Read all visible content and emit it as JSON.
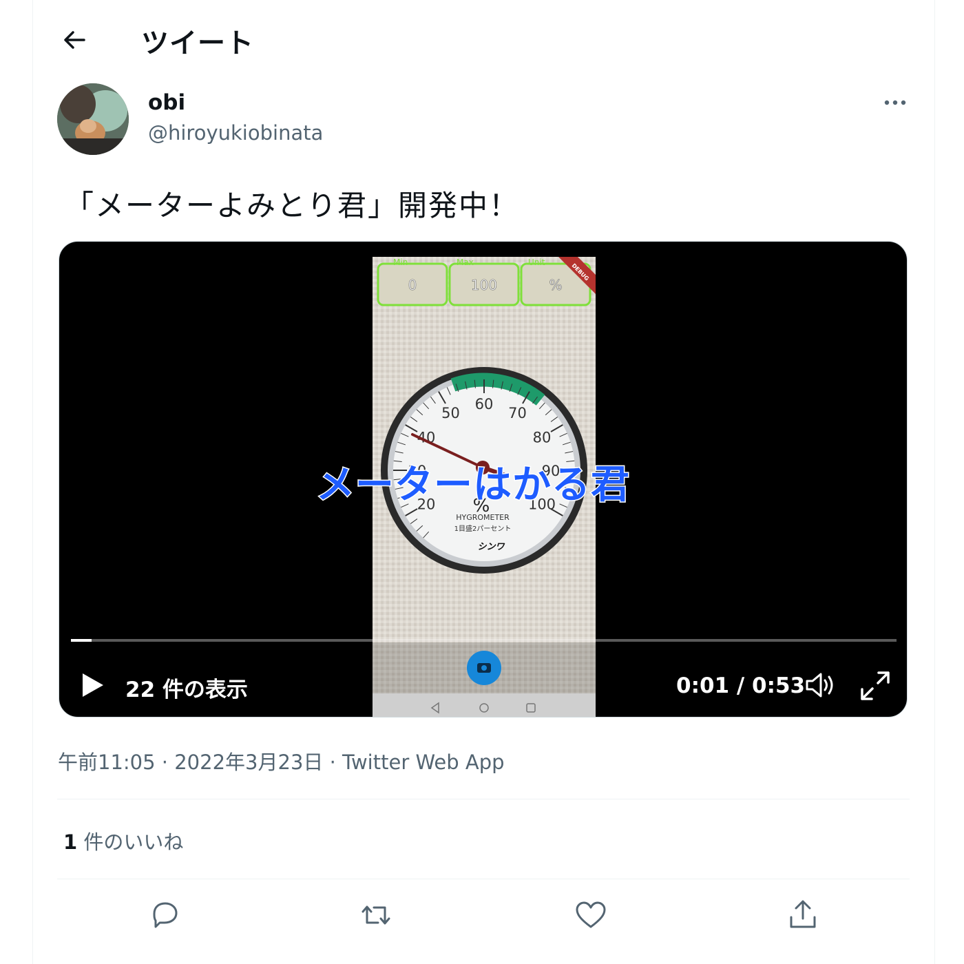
{
  "header": {
    "title": "ツイート",
    "back_icon": "arrow-left-icon"
  },
  "author": {
    "display_name": "obi",
    "handle": "@hiroyukiobinata"
  },
  "tweet": {
    "text": "「メーターよみとり君」開発中！"
  },
  "video": {
    "caption": "メーターはかる君",
    "views": "22 件の表示",
    "time": "0:01 / 0:53",
    "progress": 0.025,
    "app_fields": [
      {
        "label": "Min",
        "value": "0"
      },
      {
        "label": "Max",
        "value": "100"
      },
      {
        "label": "Unit",
        "value": "%"
      }
    ],
    "ribbon": "DEBUG",
    "gauge": {
      "ticks": [
        "20",
        "30",
        "40",
        "50",
        "60",
        "70",
        "80",
        "90",
        "100"
      ],
      "unit": "%",
      "name": "HYGROMETER",
      "subtitle": "1目盛2パーセント",
      "brand": "シンワ"
    }
  },
  "meta": {
    "time": "午前11:05",
    "date": "2022年3月23日",
    "source": "Twitter Web App",
    "sep": " · "
  },
  "likes": {
    "count": "1",
    "label": " 件のいいね"
  },
  "actions": [
    "reply-icon",
    "retweet-icon",
    "like-icon",
    "share-icon"
  ],
  "colors": {
    "caption": "#1e5cff",
    "gauge_green": "#1e9a6a",
    "field_border": "#7fe03a",
    "camera_button": "#1687d9"
  }
}
